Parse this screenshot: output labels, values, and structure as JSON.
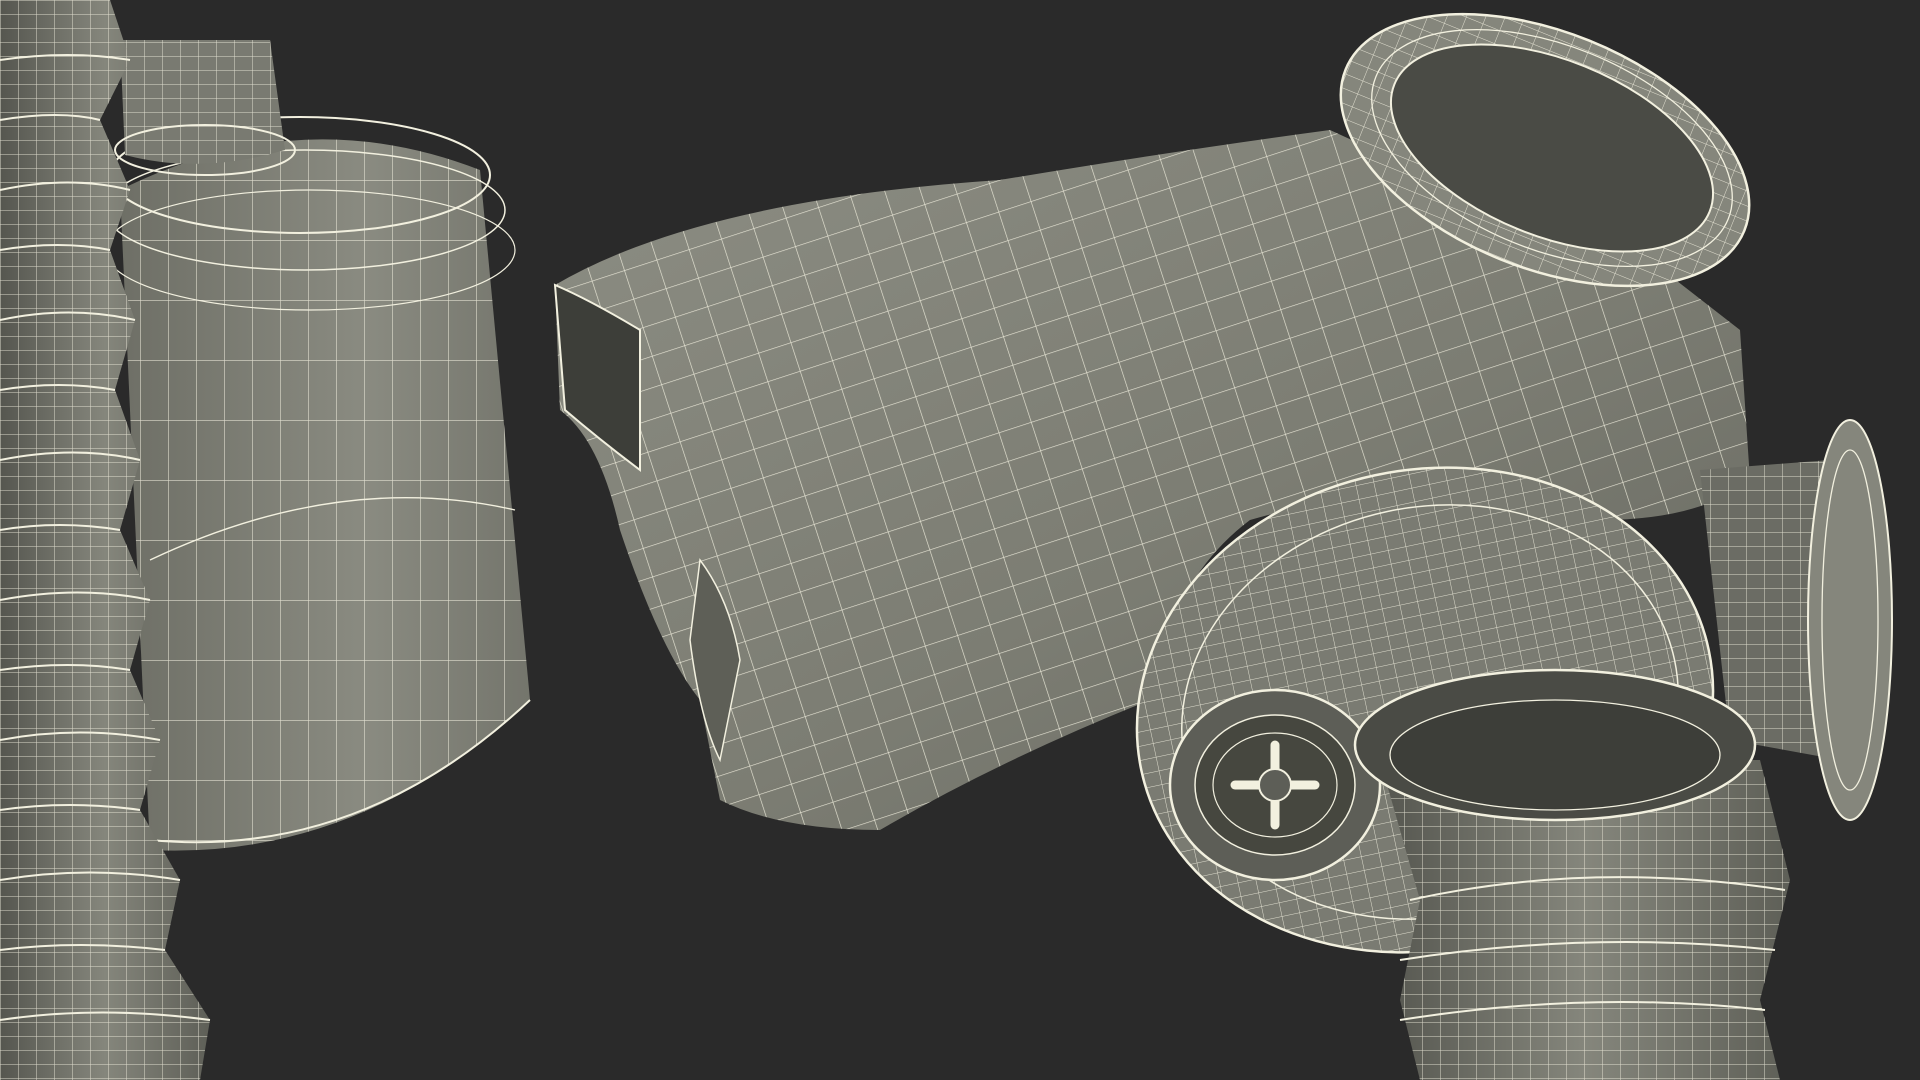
{
  "scene": {
    "subject": "gas-mask-wireframe-render",
    "colors": {
      "background": "#2a2a2a",
      "mesh_fill": "#7f8076",
      "mesh_fill_light": "#8e8f85",
      "mesh_fill_dark": "#5e5f57",
      "mesh_shadow": "#3d3e39",
      "wire": "#f2f0df"
    }
  }
}
